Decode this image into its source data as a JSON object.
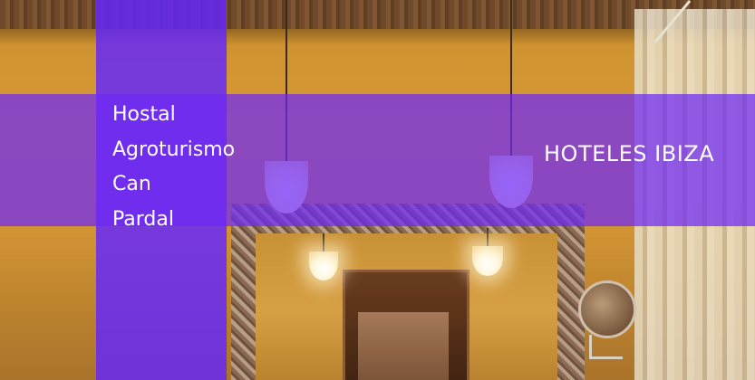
{
  "banner": {
    "title_lines": [
      "Hostal",
      "Agroturismo",
      "Can",
      "Pardal"
    ],
    "category": "HOTELES IBIZA"
  },
  "colors": {
    "overlay": "#6224ff",
    "text": "#ffffff"
  },
  "background": {
    "photo_elements": [
      "wooden-ceiling",
      "pendant-lamp",
      "pendant-lamp",
      "pendant-lamp",
      "pendant-lamp",
      "carved-mirror",
      "wooden-door",
      "round-vanity-mirror",
      "curtain"
    ]
  }
}
